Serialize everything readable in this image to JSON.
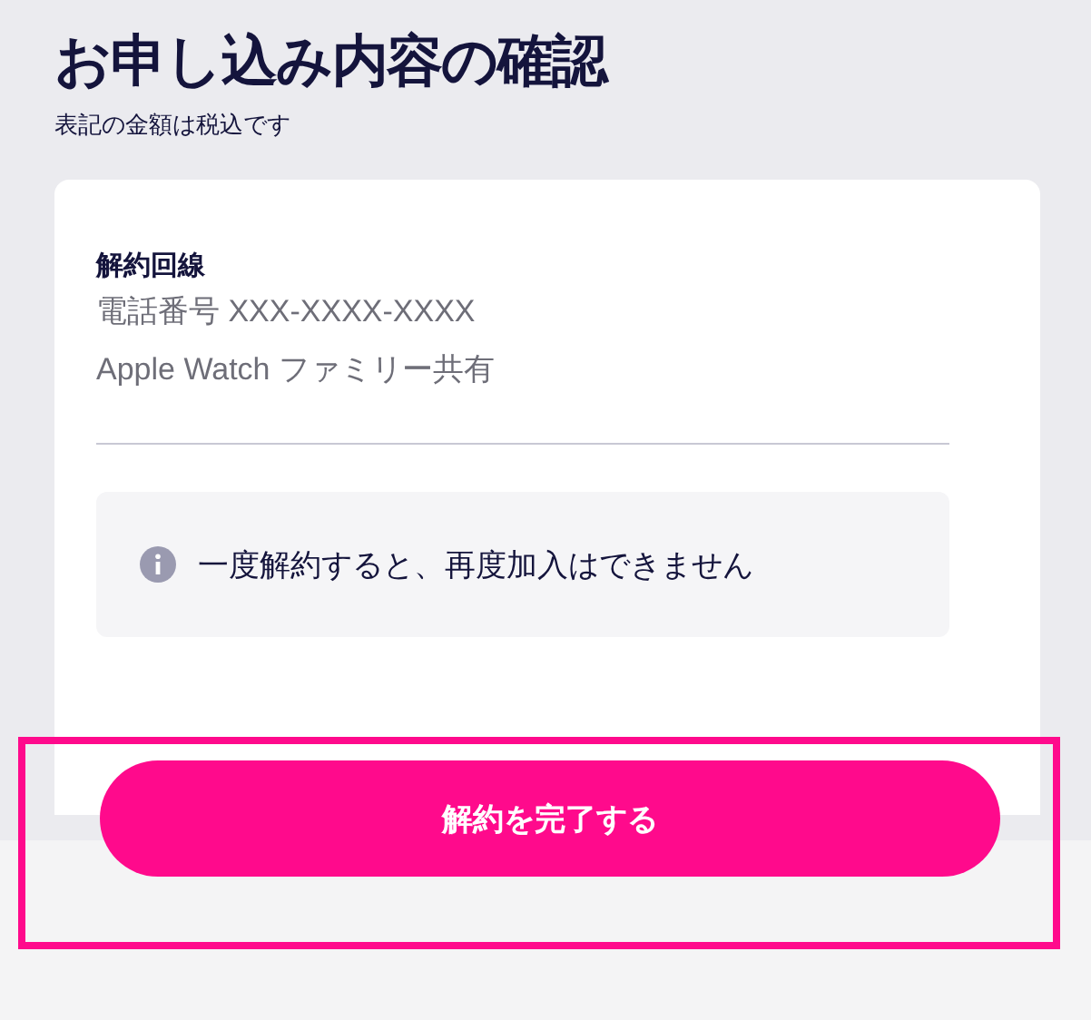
{
  "title": "お申し込み内容の確認",
  "subtitle": "表記の金額は税込です",
  "card": {
    "label": "解約回線",
    "lines": [
      "電話番号 XXX-XXXX-XXXX",
      "Apple Watch ファミリー共有"
    ],
    "notice": "一度解約すると、再度加入はできません"
  },
  "action_button": "解約を完了する"
}
